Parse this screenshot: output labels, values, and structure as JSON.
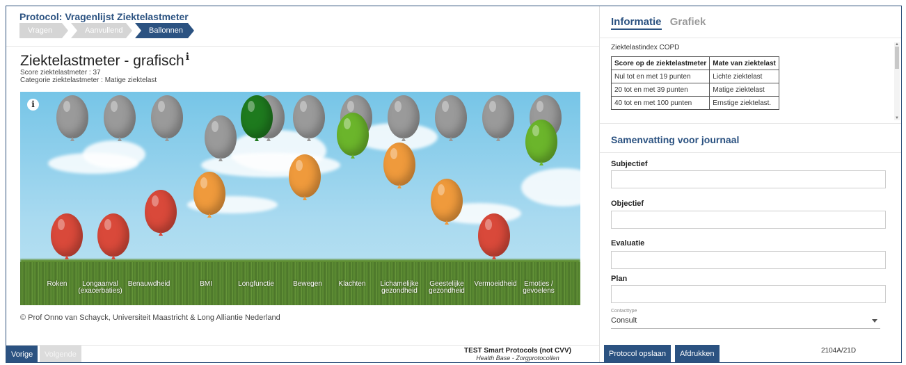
{
  "protocol": {
    "title": "Protocol: Vragenlijst Ziektelastmeter"
  },
  "steps": [
    {
      "label": "Vragen",
      "active": false
    },
    {
      "label": "Aanvullend",
      "active": false
    },
    {
      "label": "Ballonnen",
      "active": true
    }
  ],
  "graph": {
    "title": "Ziektelastmeter - grafisch",
    "info_glyph": "ℹ",
    "score_line": "Score ziektelastmeter : 37",
    "category_line": "Categorie ziektelastmeter : Matige ziektelast",
    "scene_info_glyph": "i"
  },
  "balloons": [
    {
      "label": "Roken",
      "color": "#d9493a",
      "gray_shown": true
    },
    {
      "label": "Longaanval\n(exacerbaties)",
      "color": "#d9493a",
      "gray_shown": true
    },
    {
      "label": "Benauwdheid",
      "color": "#d9493a",
      "gray_shown": true
    },
    {
      "label": "BMI",
      "color": "#ef9a3c",
      "gray_shown": true
    },
    {
      "label": "Longfunctie",
      "color": "#1e7a1e",
      "gray_shown": true
    },
    {
      "label": "Bewegen",
      "color": "#ef9a3c",
      "gray_shown": true
    },
    {
      "label": "Klachten",
      "color": "#6bb52b",
      "gray_shown": true
    },
    {
      "label": "Lichamelijke\ngezondheid",
      "color": "#ef9a3c",
      "gray_shown": true
    },
    {
      "label": "Geestelijke\ngezondheid",
      "color": "#ef9a3c",
      "gray_shown": true
    },
    {
      "label": "Vermoeidheid",
      "color": "#d9493a",
      "gray_shown": true
    },
    {
      "label": "Emoties /\ngevoelens",
      "color": "#6bb52b",
      "gray_shown": true
    }
  ],
  "balloon_colors": {
    "gray": "#9a9a9a",
    "red": "#d9493a",
    "orange": "#ef9a3c",
    "light_green": "#6bb52b",
    "dark_green": "#1e7a1e"
  },
  "copyright": "© Prof Onno van Schayck, Universiteit Maastricht & Long Alliantie Nederland",
  "footer": {
    "prev_label": "Vorige",
    "next_label": "Volgende",
    "org_line": "TEST Smart Protocols (not CVV)",
    "sub_line": "Health Base - Zorgprotocollen",
    "save_label": "Protocol opslaan",
    "print_label": "Afdrukken",
    "version": "2104A/21D"
  },
  "right_tabs": [
    {
      "label": "Informatie",
      "active": true
    },
    {
      "label": "Grafiek",
      "active": false
    }
  ],
  "info": {
    "heading": "Ziektelastindex COPD",
    "table_headers": [
      "Score op de ziektelastmeter",
      "Mate van ziektelast"
    ],
    "table_rows": [
      [
        "Nul tot en met 19 punten",
        "Lichte ziektelast"
      ],
      [
        "20 tot en met 39 punten",
        "Matige ziektelast"
      ],
      [
        "40 tot en met 100 punten",
        "Ernstige ziektelast."
      ]
    ]
  },
  "summary": {
    "title": "Samenvatting voor journaal",
    "fields": [
      {
        "label": "Subjectief",
        "value": ""
      },
      {
        "label": "Objectief",
        "value": ""
      },
      {
        "label": "Evaluatie",
        "value": ""
      },
      {
        "label": "Plan",
        "value": ""
      }
    ],
    "contact_type_label": "Contacttype",
    "contact_type_value": "Consult"
  },
  "accent_color": "#2b5281"
}
